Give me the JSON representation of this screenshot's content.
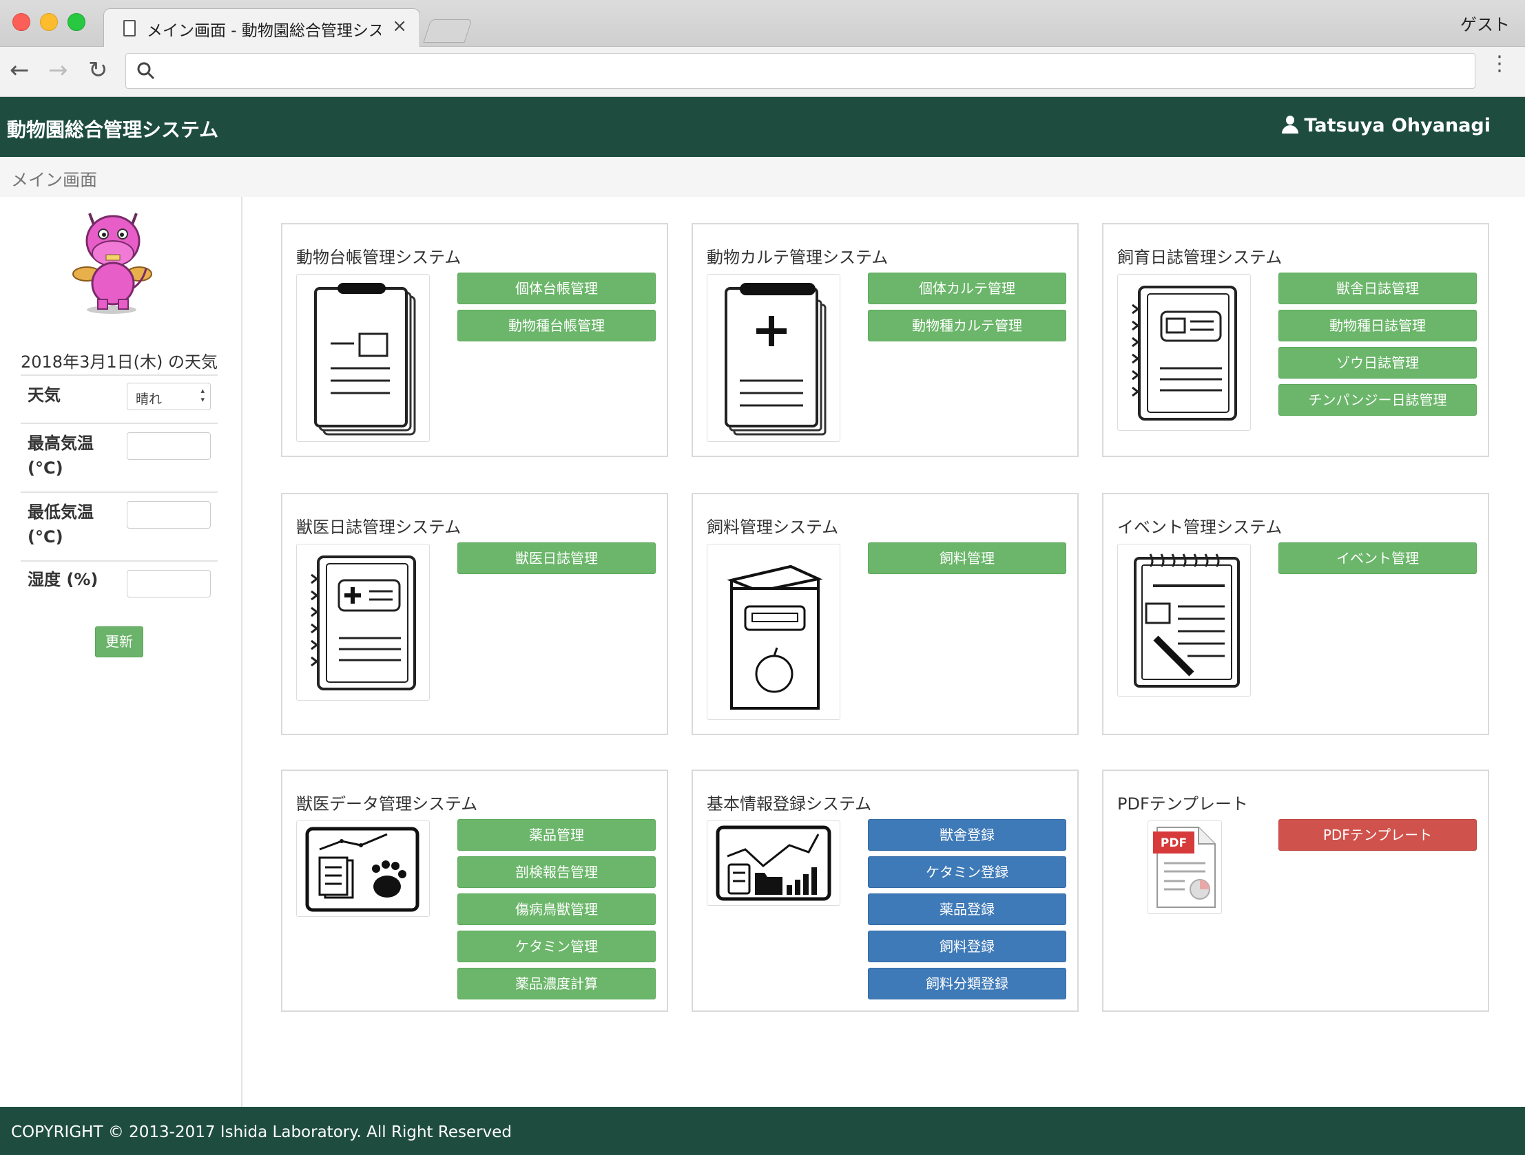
{
  "browser": {
    "tab_title": "メイン画面 - 動物園総合管理システム",
    "tab_close": "×",
    "profile": "ゲスト",
    "back": "←",
    "forward": "→",
    "reload": "↻",
    "search_icon": "search-icon",
    "menu": "⋮"
  },
  "header": {
    "app_title": "動物園総合管理システム",
    "user_name": "Tatsuya Ohyanagi"
  },
  "breadcrumb": {
    "current": "メイン画面"
  },
  "sidebar": {
    "weather_title": "2018年3月1日(木) の天気",
    "weather_label": "天気",
    "weather_value": "晴れ",
    "max_temp_label": "最高気温",
    "max_temp_unit": "(°C)",
    "max_temp_value": "",
    "min_temp_label": "最低気温",
    "min_temp_unit": "(°C)",
    "min_temp_value": "",
    "humidity_label": "湿度 (%)",
    "humidity_value": "",
    "update_button": "更新"
  },
  "panels": [
    {
      "title": "動物台帳管理システム",
      "buttons": [
        "個体台帳管理",
        "動物種台帳管理"
      ]
    },
    {
      "title": "動物カルテ管理システム",
      "buttons": [
        "個体カルテ管理",
        "動物種カルテ管理"
      ]
    },
    {
      "title": "飼育日誌管理システム",
      "buttons": [
        "獣舎日誌管理",
        "動物種日誌管理",
        "ゾウ日誌管理",
        "チンパンジー日誌管理"
      ]
    },
    {
      "title": "獣医日誌管理システム",
      "buttons": [
        "獣医日誌管理"
      ]
    },
    {
      "title": "飼料管理システム",
      "buttons": [
        "飼料管理"
      ]
    },
    {
      "title": "イベント管理システム",
      "buttons": [
        "イベント管理"
      ]
    },
    {
      "title": "獣医データ管理システム",
      "buttons": [
        "薬品管理",
        "剖検報告管理",
        "傷病鳥獣管理",
        "ケタミン管理",
        "薬品濃度計算"
      ]
    },
    {
      "title": "基本情報登録システム",
      "buttons": [
        "獣舎登録",
        "ケタミン登録",
        "薬品登録",
        "飼料登録",
        "飼料分類登録"
      ]
    },
    {
      "title": "PDFテンプレート",
      "buttons": [
        "PDFテンプレート"
      ],
      "pdf_badge": "PDF"
    }
  ],
  "colors": {
    "header_bg": "#1e4d40",
    "button_green": "#6bb66a",
    "button_blue": "#3f7ab8",
    "button_red": "#d0524c"
  },
  "footer": {
    "copyright": "COPYRIGHT © 2013-2017 Ishida Laboratory. All Right Reserved"
  }
}
